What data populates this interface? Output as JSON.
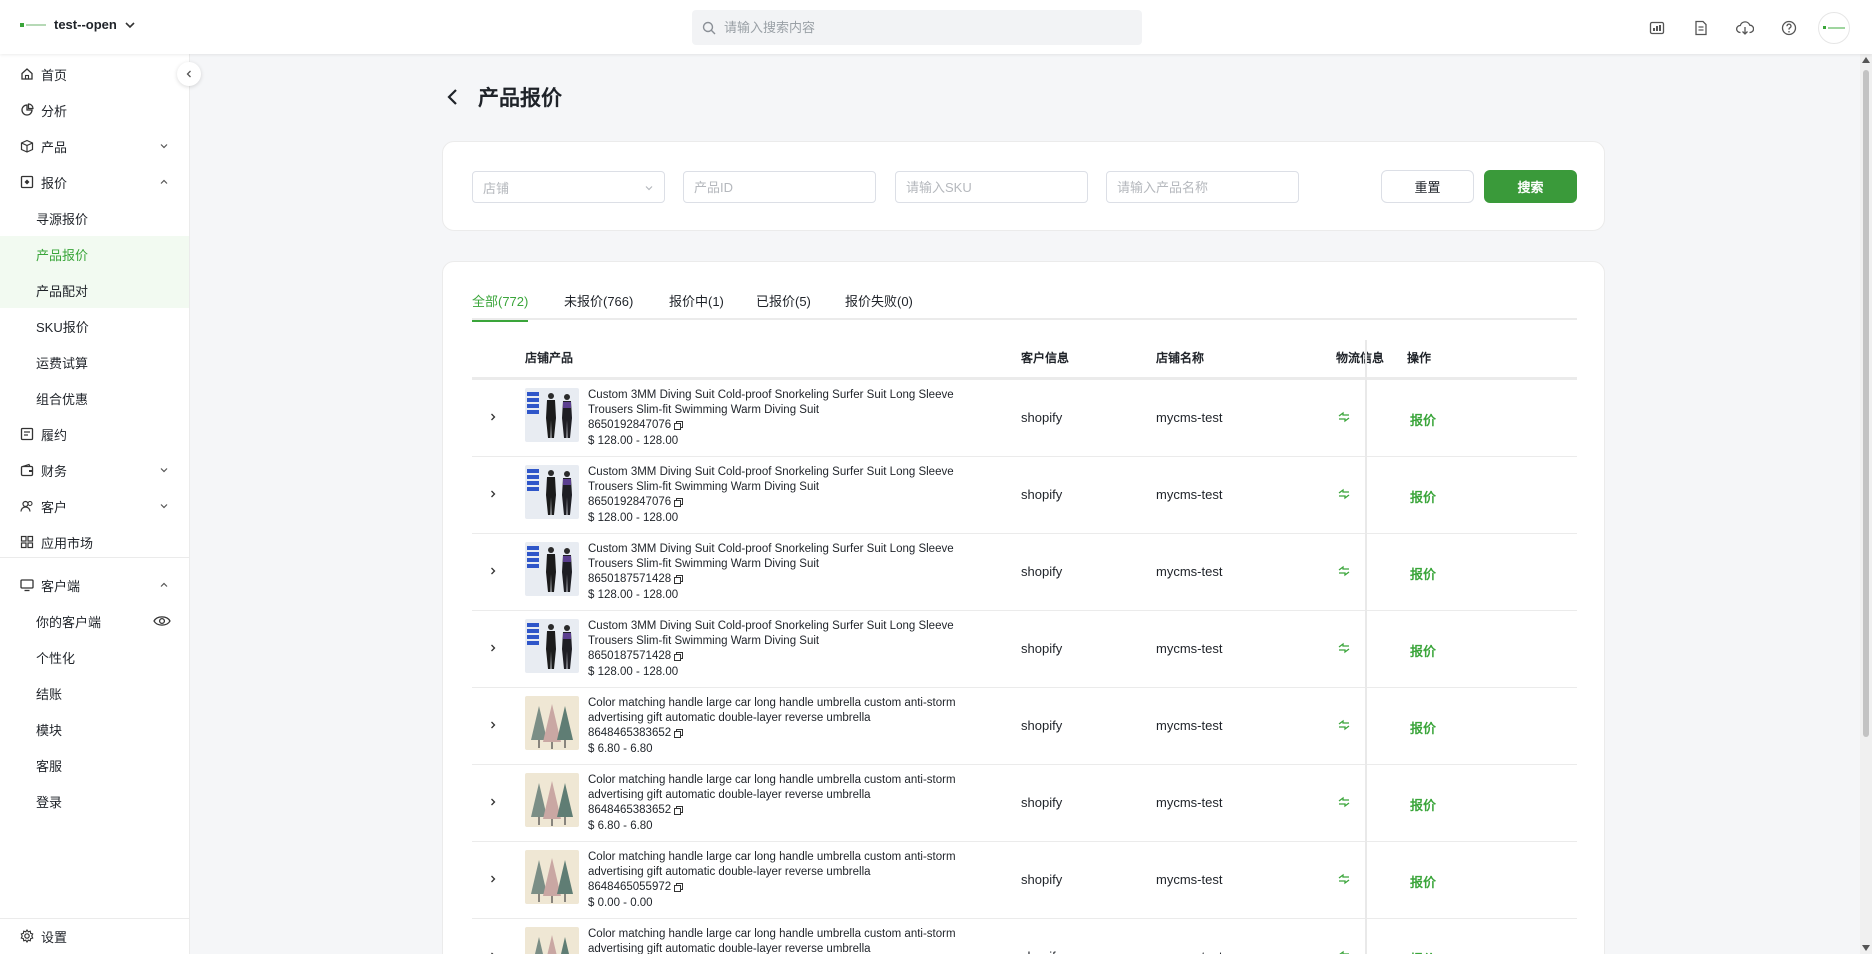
{
  "colors": {
    "accent": "#3aa53a",
    "primary_button": "#3a9a3a"
  },
  "header": {
    "brand_name": "test--open",
    "search_placeholder": "请输入搜索内容",
    "icons": [
      "report-icon",
      "document-icon",
      "cloud-download-icon",
      "help-icon"
    ]
  },
  "sidebar": {
    "items": [
      {
        "label": "首页",
        "icon": "home-icon"
      },
      {
        "label": "分析",
        "icon": "analytics-icon"
      },
      {
        "label": "产品",
        "icon": "box-icon"
      },
      {
        "label": "报价",
        "icon": "quote-icon"
      },
      {
        "label": "履约",
        "icon": "fulfillment-icon"
      },
      {
        "label": "财务",
        "icon": "wallet-icon"
      },
      {
        "label": "客户",
        "icon": "users-icon"
      },
      {
        "label": "应用市场",
        "icon": "apps-icon"
      },
      {
        "label": "客户端",
        "icon": "monitor-icon"
      }
    ],
    "quote_sub": [
      "寻源报价",
      "产品报价",
      "产品配对",
      "SKU报价",
      "运费试算",
      "组合优惠"
    ],
    "client_sub": [
      "你的客户端",
      "个性化",
      "结账",
      "模块",
      "客服",
      "登录"
    ],
    "settings": "设置"
  },
  "page": {
    "title": "产品报价"
  },
  "filters": {
    "store_placeholder": "店铺",
    "product_id_placeholder": "产品ID",
    "sku_placeholder": "请输入SKU",
    "name_placeholder": "请输入产品名称",
    "reset_label": "重置",
    "search_label": "搜索"
  },
  "tabs": [
    "全部(772)",
    "未报价(766)",
    "报价中(1)",
    "已报价(5)",
    "报价失败(0)"
  ],
  "table": {
    "columns": [
      "店铺产品",
      "客户信息",
      "店铺名称",
      "物流信息",
      "操作"
    ],
    "rows": [
      {
        "name": "Custom 3MM Diving Suit Cold-proof Snorkeling Surfer Suit Long Sleeve Trousers Slim-fit Swimming Warm Diving Suit",
        "id": "8650192847076",
        "price": "$ 128.00 - 128.00",
        "customer": "shopify",
        "shop": "mycms-test",
        "action": "报价",
        "thumb": "wetsuit"
      },
      {
        "name": "Custom 3MM Diving Suit Cold-proof Snorkeling Surfer Suit Long Sleeve Trousers Slim-fit Swimming Warm Diving Suit",
        "id": "8650192847076",
        "price": "$ 128.00 - 128.00",
        "customer": "shopify",
        "shop": "mycms-test",
        "action": "报价",
        "thumb": "wetsuit"
      },
      {
        "name": "Custom 3MM Diving Suit Cold-proof Snorkeling Surfer Suit Long Sleeve Trousers Slim-fit Swimming Warm Diving Suit",
        "id": "8650187571428",
        "price": "$ 128.00 - 128.00",
        "customer": "shopify",
        "shop": "mycms-test",
        "action": "报价",
        "thumb": "wetsuit"
      },
      {
        "name": "Custom 3MM Diving Suit Cold-proof Snorkeling Surfer Suit Long Sleeve Trousers Slim-fit Swimming Warm Diving Suit",
        "id": "8650187571428",
        "price": "$ 128.00 - 128.00",
        "customer": "shopify",
        "shop": "mycms-test",
        "action": "报价",
        "thumb": "wetsuit"
      },
      {
        "name": "Color matching handle large car long handle umbrella custom anti-storm advertising gift automatic double-layer reverse umbrella",
        "id": "8648465383652",
        "price": "$ 6.80 - 6.80",
        "customer": "shopify",
        "shop": "mycms-test",
        "action": "报价",
        "thumb": "umbrella"
      },
      {
        "name": "Color matching handle large car long handle umbrella custom anti-storm advertising gift automatic double-layer reverse umbrella",
        "id": "8648465383652",
        "price": "$ 6.80 - 6.80",
        "customer": "shopify",
        "shop": "mycms-test",
        "action": "报价",
        "thumb": "umbrella"
      },
      {
        "name": "Color matching handle large car long handle umbrella custom anti-storm advertising gift automatic double-layer reverse umbrella",
        "id": "8648465055972",
        "price": "$ 0.00 - 0.00",
        "customer": "shopify",
        "shop": "mycms-test",
        "action": "报价",
        "thumb": "umbrella"
      },
      {
        "name": "Color matching handle large car long handle umbrella custom anti-storm advertising gift automatic double-layer reverse umbrella",
        "id": "",
        "price": "",
        "customer": "shopify",
        "shop": "mycms-test",
        "action": "报价",
        "thumb": "umbrella"
      }
    ]
  }
}
